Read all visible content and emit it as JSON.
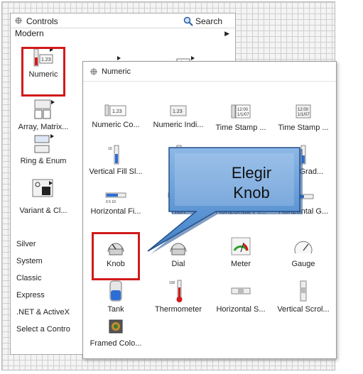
{
  "controls": {
    "title": "Controls",
    "search_label": "Search",
    "section": "Modern",
    "items": [
      {
        "label": "Numeric"
      },
      {
        "label": "Array, Matrix..."
      },
      {
        "label": "Ring & Enum"
      },
      {
        "label": "Variant & Cl..."
      }
    ],
    "categories": [
      "Silver",
      "System",
      "Classic",
      "Express",
      ".NET & ActiveX",
      "Select a Contro"
    ]
  },
  "numeric": {
    "title": "Numeric",
    "items": [
      {
        "label": "Numeric Co..."
      },
      {
        "label": "Numeric Indi..."
      },
      {
        "label": "Time Stamp ..."
      },
      {
        "label": "Time Stamp ..."
      },
      {
        "label": "Vertical Fill Sl..."
      },
      {
        "label": "Vert"
      },
      {
        "label": ""
      },
      {
        "label": "tical Grad..."
      },
      {
        "label": "Horizontal Fi..."
      },
      {
        "label": "Hori"
      },
      {
        "label": "Horizontal Pi..."
      },
      {
        "label": "Horizontal G..."
      },
      {
        "label": "Knob"
      },
      {
        "label": "Dial"
      },
      {
        "label": "Meter"
      },
      {
        "label": "Gauge"
      },
      {
        "label": "Tank"
      },
      {
        "label": "Thermometer"
      },
      {
        "label": "Horizontal S..."
      },
      {
        "label": "Vertical Scrol..."
      },
      {
        "label": "Framed Colo..."
      }
    ]
  },
  "callout": {
    "line1": "Elegir",
    "line2": "Knob"
  },
  "colors": {
    "highlight": "#d11a1a",
    "callout_fill": "#5b9bd5"
  }
}
